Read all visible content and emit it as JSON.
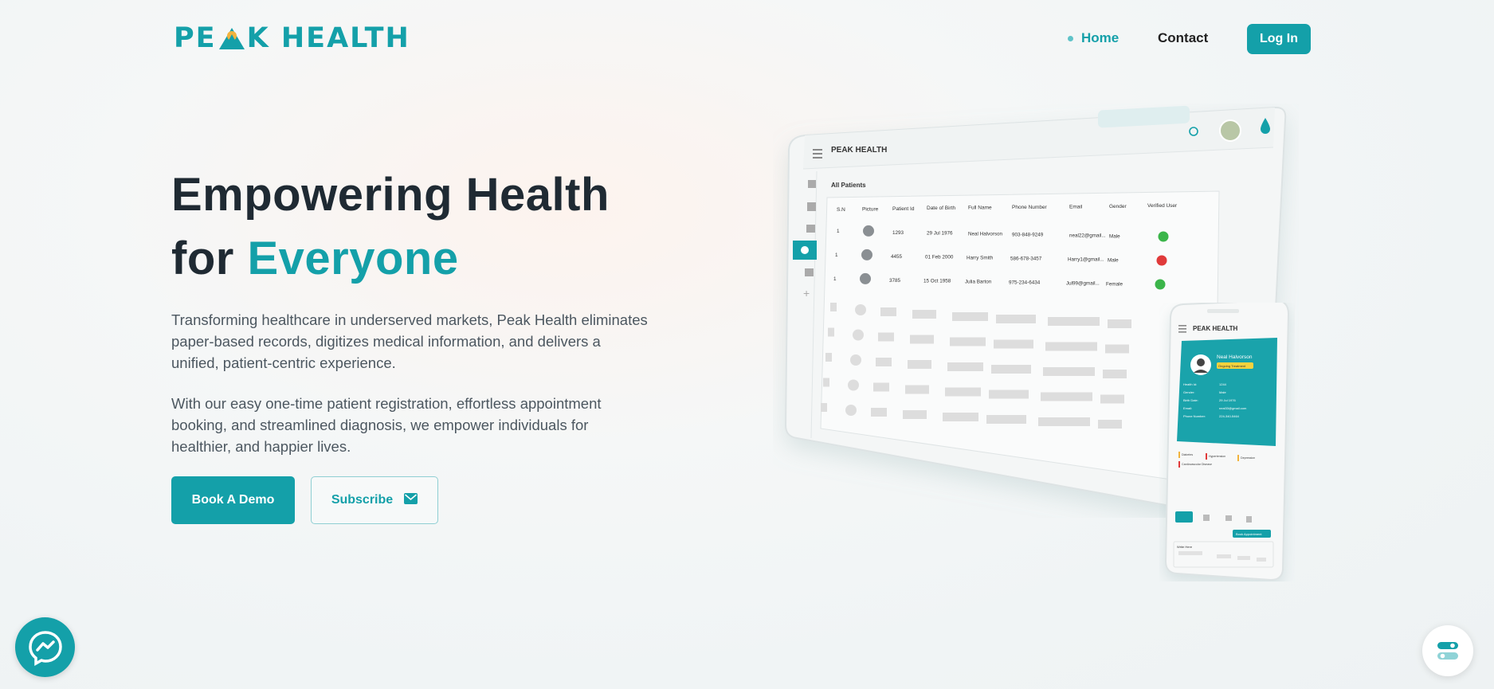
{
  "brand": {
    "name_left": "PE",
    "name_right": "K HEALTH"
  },
  "nav": {
    "home": "Home",
    "contact": "Contact",
    "login": "Log In"
  },
  "hero": {
    "title_line1": "Empowering Health",
    "title_line2_prefix": "for ",
    "title_line2_highlight": "Everyone",
    "paragraph1": "Transforming healthcare in underserved markets, Peak Health eliminates paper-based records, digitizes medical information, and delivers a unified, patient-centric experience.",
    "paragraph2": "With our easy one-time patient registration, effortless appointment booking, and streamlined diagnosis, we empower individuals for healthier, and happier lives.",
    "book_demo": "Book A Demo",
    "subscribe": "Subscribe"
  },
  "icons": {
    "nav_dot": "dot-icon",
    "subscribe": "mail-icon",
    "chat": "messenger-icon",
    "widget": "toggle-icon"
  },
  "colors": {
    "accent": "#14a0a9",
    "text_dark": "#1f2a33",
    "text_body": "#4c5760"
  },
  "mockup": {
    "tablet": {
      "brand": "PEAK HEALTH",
      "section_title": "All Patients",
      "columns": [
        "S.N",
        "Picture",
        "Patient Id",
        "Date of Birth",
        "Full Name",
        "Phone Number",
        "Email",
        "Gender",
        "Verified User"
      ],
      "rows": [
        {
          "sn": "1",
          "id": "1293",
          "dob": "29 Jul 1976",
          "name": "Neal Halvorson",
          "phone": "903-848-9249",
          "email": "neal22@gmail...",
          "gender": "Male",
          "verified": true
        },
        {
          "sn": "1",
          "id": "4455",
          "dob": "01 Feb 2000",
          "name": "Harry Smith",
          "phone": "586-678-3457",
          "email": "Harry1@gmail...",
          "gender": "Male",
          "verified": false
        },
        {
          "sn": "1",
          "id": "3785",
          "dob": "15 Oct 1958",
          "name": "Julia Barton",
          "phone": "975-234-6434",
          "email": "Jul99@gmail...",
          "gender": "Female",
          "verified": true
        }
      ]
    },
    "phone": {
      "brand": "PEAK HEALTH",
      "patient_name": "Neal Halvorson",
      "status_badge": "Ongoing Treatment",
      "fields": [
        {
          "label": "Health Id:",
          "value": "1244"
        },
        {
          "label": "Gender:",
          "value": "Male"
        },
        {
          "label": "Birth Date:",
          "value": "29 Jul 1976"
        },
        {
          "label": "Email:",
          "value": "neal33@gmail.com"
        },
        {
          "label": "Phone Number:",
          "value": "224-340-5464"
        }
      ],
      "tags": [
        "Diabetes",
        "Hypertension",
        "Depression",
        "Cardiovascular Disease"
      ],
      "book_button": "Book Appointment",
      "notes_label": "Write Here"
    }
  }
}
